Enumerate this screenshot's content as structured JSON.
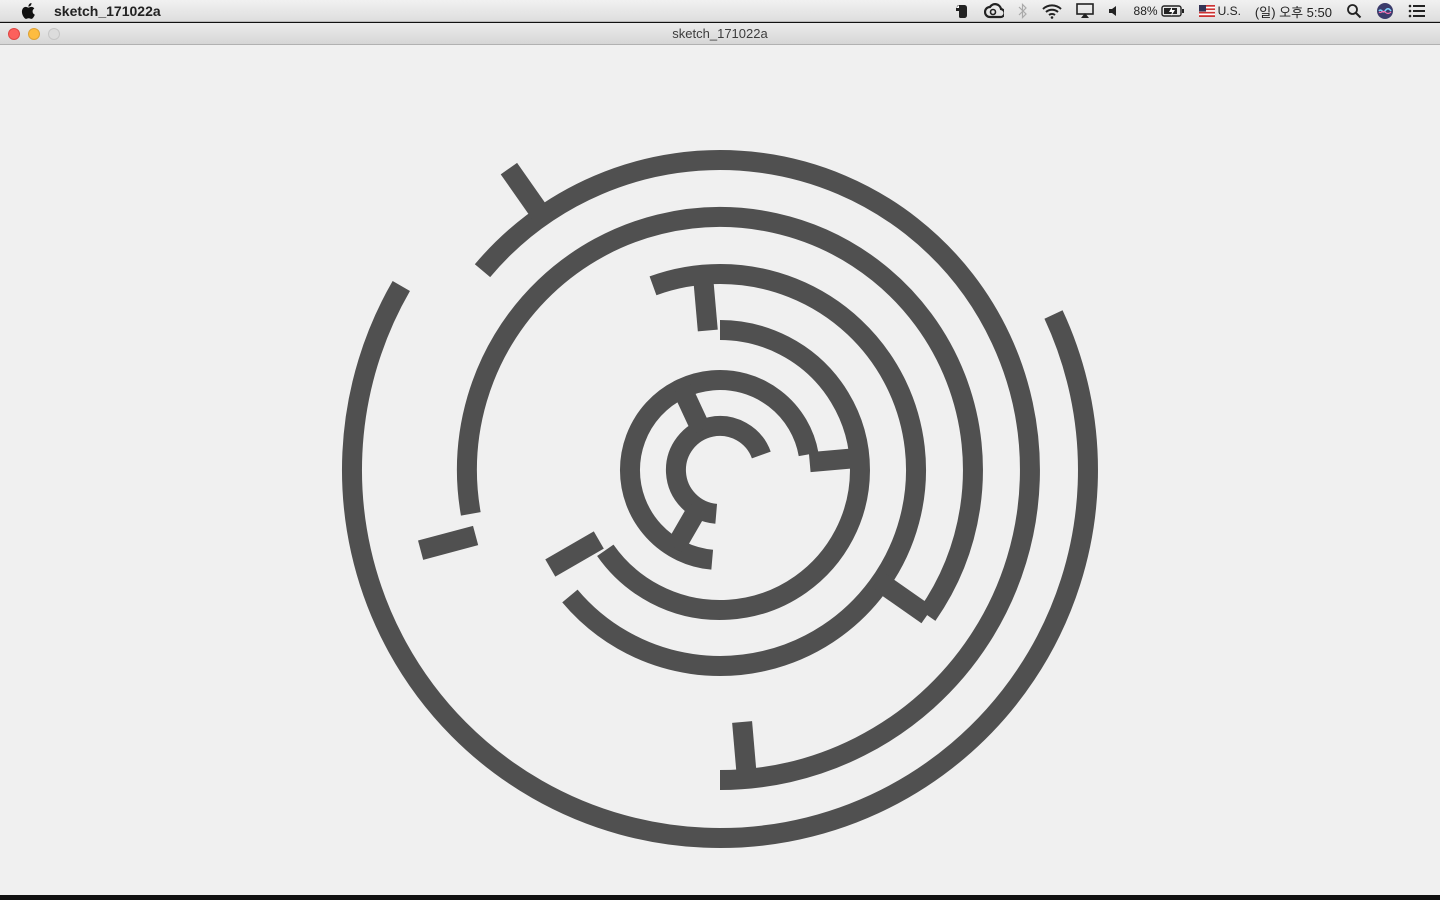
{
  "menubar": {
    "app_name": "sketch_171022a",
    "battery_percent": "88%",
    "input_source": "U.S.",
    "clock": "(일) 오후 5:50",
    "icons": [
      "apple-icon",
      "evernote-icon",
      "creative-cloud-icon",
      "bluetooth-icon",
      "wifi-icon",
      "airplay-icon",
      "volume-icon",
      "battery-icon",
      "us-flag-icon",
      "spotlight-icon",
      "siri-icon",
      "notification-center-icon"
    ]
  },
  "window": {
    "title": "sketch_171022a"
  },
  "sketch": {
    "stroke_color": "#505050",
    "background_color": "#f0f0f0",
    "shape": "concentric broken-ring maze spiral"
  }
}
